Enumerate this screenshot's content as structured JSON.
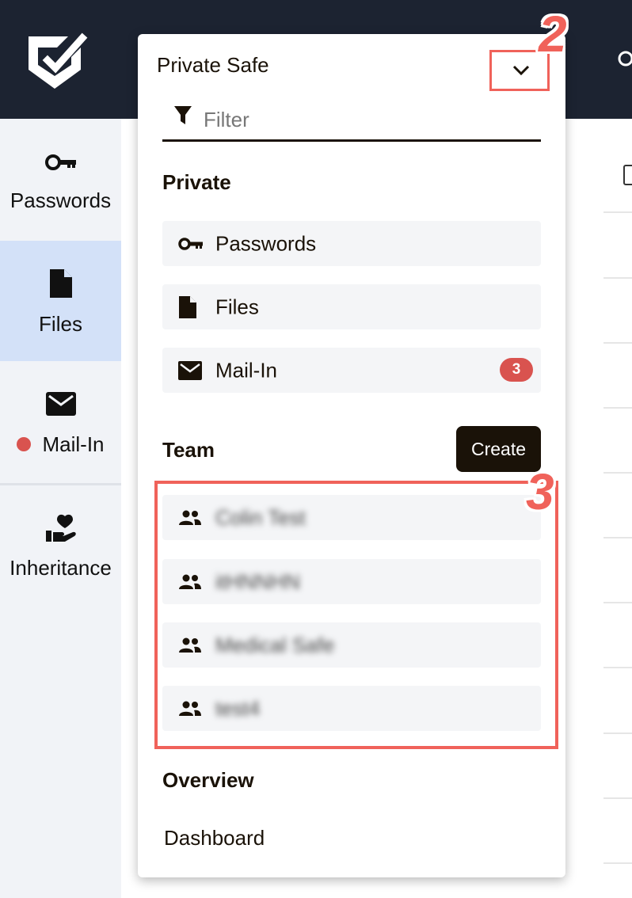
{
  "sidebar": {
    "items": [
      {
        "label": "Passwords",
        "icon": "key-icon"
      },
      {
        "label": "Files",
        "icon": "file-icon"
      },
      {
        "label": "Mail-In",
        "icon": "mail-icon"
      },
      {
        "label": "Inheritance",
        "icon": "heart-hand-icon"
      }
    ]
  },
  "dropdown": {
    "title": "Private Safe",
    "filter_placeholder": "Filter",
    "private_title": "Private",
    "private_items": [
      {
        "label": "Passwords",
        "icon": "key-icon"
      },
      {
        "label": "Files",
        "icon": "file-icon"
      },
      {
        "label": "Mail-In",
        "icon": "mail-icon",
        "badge": "3"
      }
    ],
    "team_title": "Team",
    "create_label": "Create",
    "team_items": [
      {
        "label": "Colin Test",
        "icon": "team-icon"
      },
      {
        "label": "itHNNHN",
        "icon": "team-icon"
      },
      {
        "label": "Medical Safe",
        "icon": "team-icon"
      },
      {
        "label": "test4",
        "icon": "team-icon"
      }
    ],
    "overview_title": "Overview",
    "dashboard_label": "Dashboard"
  },
  "annotations": {
    "chevron": "2",
    "team_box": "3"
  },
  "colors": {
    "topbar": "#1c2331",
    "sidebar": "#f1f3f7",
    "active": "#d3e1f8",
    "highlight": "#f0625a",
    "badge": "#d9534f",
    "dark": "#1a1208"
  }
}
